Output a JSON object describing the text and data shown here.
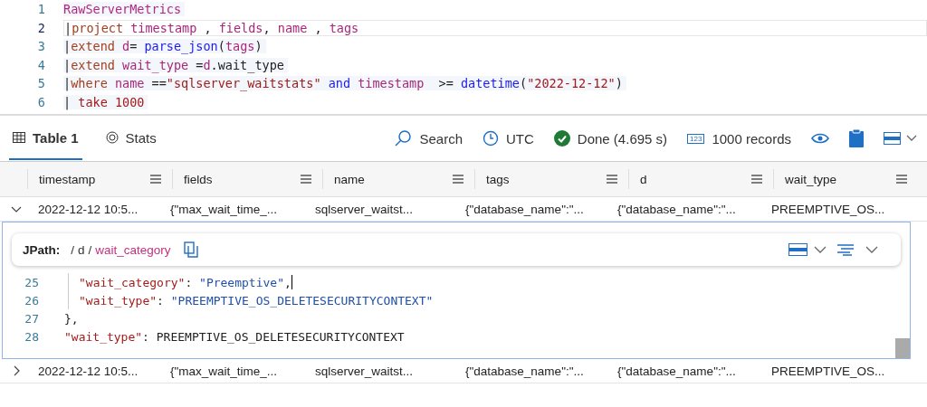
{
  "query": {
    "lines": [
      {
        "number": "1",
        "current": false,
        "tokens": [
          {
            "text": "RawServerMetrics",
            "kind": "table"
          }
        ]
      },
      {
        "number": "2",
        "current": true,
        "tokens": [
          {
            "text": "|",
            "kind": "plain"
          },
          {
            "text": "project ",
            "kind": "keyword"
          },
          {
            "text": "timestamp",
            "kind": "column"
          },
          {
            "text": " , ",
            "kind": "plain"
          },
          {
            "text": "fields",
            "kind": "column"
          },
          {
            "text": ", ",
            "kind": "plain"
          },
          {
            "text": "name",
            "kind": "column"
          },
          {
            "text": " , ",
            "kind": "plain"
          },
          {
            "text": "tags",
            "kind": "column"
          }
        ]
      },
      {
        "number": "3",
        "current": false,
        "tokens": [
          {
            "text": "|",
            "kind": "plain"
          },
          {
            "text": "extend ",
            "kind": "keyword"
          },
          {
            "text": "d",
            "kind": "column"
          },
          {
            "text": "= ",
            "kind": "plain"
          },
          {
            "text": "parse_json",
            "kind": "function"
          },
          {
            "text": "(",
            "kind": "plain"
          },
          {
            "text": "tags",
            "kind": "column"
          },
          {
            "text": ")",
            "kind": "plain"
          }
        ]
      },
      {
        "number": "4",
        "current": false,
        "tokens": [
          {
            "text": "|",
            "kind": "plain"
          },
          {
            "text": "extend ",
            "kind": "keyword"
          },
          {
            "text": "wait_type",
            "kind": "column"
          },
          {
            "text": " =",
            "kind": "plain"
          },
          {
            "text": "d",
            "kind": "column"
          },
          {
            "text": ".wait_type",
            "kind": "plain"
          }
        ]
      },
      {
        "number": "5",
        "current": false,
        "tokens": [
          {
            "text": "|",
            "kind": "plain"
          },
          {
            "text": "where ",
            "kind": "keyword"
          },
          {
            "text": "name",
            "kind": "column"
          },
          {
            "text": " ==",
            "kind": "plain"
          },
          {
            "text": "\"sqlserver_waitstats\" ",
            "kind": "string"
          },
          {
            "text": "and ",
            "kind": "function"
          },
          {
            "text": "timestamp",
            "kind": "column"
          },
          {
            "text": "  >= ",
            "kind": "plain"
          },
          {
            "text": "datetime",
            "kind": "function"
          },
          {
            "text": "(",
            "kind": "plain"
          },
          {
            "text": "\"2022-12-12\"",
            "kind": "string"
          },
          {
            "text": ")",
            "kind": "plain"
          }
        ]
      },
      {
        "number": "6",
        "current": false,
        "tokens": [
          {
            "text": "| ",
            "kind": "plain"
          },
          {
            "text": "take 1000",
            "kind": "string"
          }
        ]
      }
    ]
  },
  "results": {
    "tabs": [
      {
        "label": "Table 1",
        "selected": true
      },
      {
        "label": "Stats",
        "selected": false
      }
    ],
    "toolbar": {
      "search": "Search",
      "timezone": "UTC",
      "status": "Done (4.695 s)",
      "records": "1000 records",
      "records_badge": "123"
    },
    "columns": [
      "timestamp",
      "fields",
      "name",
      "tags",
      "d",
      "wait_type"
    ],
    "rows": [
      {
        "expanded": true,
        "cells": [
          "2022-12-12 10:5...",
          "{\"max_wait_time_...",
          "sqlserver_waitst...",
          "{\"database_name\":\"...",
          "{\"database_name\":\"...",
          "PREEMPTIVE_OS..."
        ]
      },
      {
        "expanded": false,
        "cells": [
          "2022-12-12 10:5...",
          "{\"max_wait_time_...",
          "sqlserver_waitst...",
          "{\"database_name\":\"...",
          "{\"database_name\":\"...",
          "PREEMPTIVE_OS..."
        ]
      }
    ],
    "detail": {
      "jpath_label": "JPath:",
      "jpath": [
        {
          "text": "/",
          "selected": false
        },
        {
          "text": "d",
          "selected": false
        },
        {
          "text": "/",
          "selected": false
        },
        {
          "text": "wait_category",
          "selected": true
        }
      ],
      "lines": [
        {
          "kind": "block",
          "children": [
            {
              "number": "25",
              "cursor": true,
              "tokens": [
                {
                  "text": "\"wait_category\"",
                  "kind": "key"
                },
                {
                  "text": ": ",
                  "kind": "plain"
                },
                {
                  "text": "\"Preemptive\"",
                  "kind": "value"
                },
                {
                  "text": ",",
                  "kind": "plain"
                }
              ]
            },
            {
              "number": "26",
              "cursor": false,
              "tokens": [
                {
                  "text": "\"wait_type\"",
                  "kind": "key"
                },
                {
                  "text": ": ",
                  "kind": "plain"
                },
                {
                  "text": "\"PREEMPTIVE_OS_DELETESECURITYCONTEXT\"",
                  "kind": "value"
                }
              ]
            }
          ]
        },
        {
          "kind": "line",
          "number": "27",
          "cursor": false,
          "tokens": [
            {
              "text": "},",
              "kind": "plain"
            }
          ]
        },
        {
          "kind": "line",
          "number": "28",
          "cursor": false,
          "tokens": [
            {
              "text": "\"wait_type\"",
              "kind": "key"
            },
            {
              "text": ": PREEMPTIVE_OS_DELETESECURITYCONTEXT",
              "kind": "plain"
            }
          ]
        }
      ]
    }
  }
}
